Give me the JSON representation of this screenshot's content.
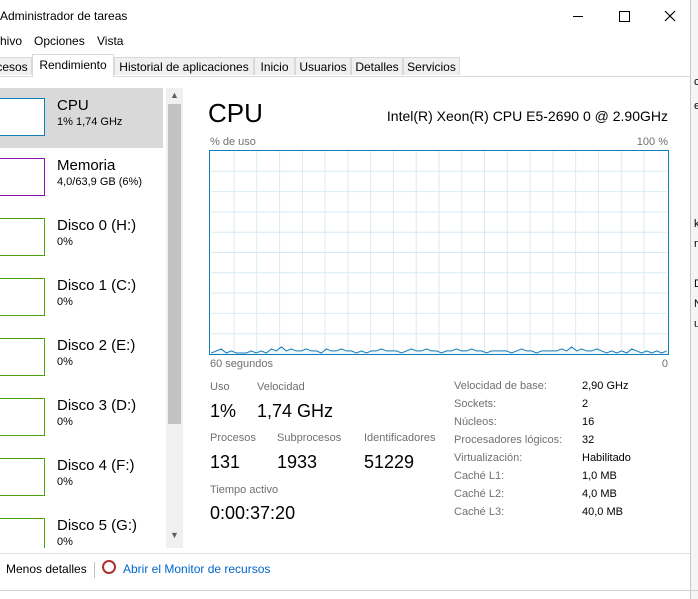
{
  "window": {
    "title": "Administrador de tareas"
  },
  "menu": [
    "hivo",
    "Opciones",
    "Vista"
  ],
  "tabs": [
    {
      "label": "cesos"
    },
    {
      "label": "Rendimiento",
      "active": true
    },
    {
      "label": "Historial de aplicaciones"
    },
    {
      "label": "Inicio"
    },
    {
      "label": "Usuarios"
    },
    {
      "label": "Detalles"
    },
    {
      "label": "Servicios"
    }
  ],
  "sidebar": {
    "items": [
      {
        "title": "CPU",
        "sub": "1% 1,74 GHz",
        "color": "#117dbb",
        "selected": true
      },
      {
        "title": "Memoria",
        "sub": "4,0/63,9 GB (6%)",
        "color": "#8b12ae"
      },
      {
        "title": "Disco 0 (H:)",
        "sub": "0%",
        "color": "#4da60c"
      },
      {
        "title": "Disco 1 (C:)",
        "sub": "0%",
        "color": "#4da60c"
      },
      {
        "title": "Disco 2 (E:)",
        "sub": "0%",
        "color": "#4da60c"
      },
      {
        "title": "Disco 3 (D:)",
        "sub": "0%",
        "color": "#4da60c"
      },
      {
        "title": "Disco 4 (F:)",
        "sub": "0%",
        "color": "#4da60c"
      },
      {
        "title": "Disco 5 (G:)",
        "sub": "0%",
        "color": "#4da60c"
      }
    ]
  },
  "main": {
    "heading": "CPU",
    "cpu_name": "Intel(R) Xeon(R) CPU E5-2690 0 @ 2.90GHz",
    "graph": {
      "top_left": "% de uso",
      "top_right": "100 %",
      "bottom_left": "60 segundos",
      "bottom_right": "0",
      "color": "#117dbb",
      "usage_percent": [
        0,
        1,
        2,
        0,
        1,
        0,
        0,
        0,
        1,
        0,
        1,
        0,
        2,
        1,
        3,
        1,
        2,
        1,
        1,
        2,
        1,
        1,
        0,
        2,
        1,
        1,
        2,
        1,
        1,
        0,
        1,
        0,
        1,
        1,
        2,
        1,
        1,
        1,
        0,
        1,
        2,
        1,
        1,
        2,
        1,
        1,
        0,
        1,
        1,
        2,
        1,
        1,
        2,
        1,
        1,
        0,
        1,
        1,
        1,
        1,
        0,
        1,
        2,
        1,
        1,
        0,
        1,
        1,
        1,
        1,
        2,
        1,
        3,
        1,
        2,
        1,
        1,
        2,
        1,
        0,
        1,
        0,
        1,
        0,
        2,
        1,
        0,
        1,
        0,
        1,
        0,
        1
      ]
    },
    "stats": {
      "uso_label": "Uso",
      "uso_value": "1%",
      "velocidad_label": "Velocidad",
      "velocidad_value": "1,74 GHz",
      "procesos_label": "Procesos",
      "procesos_value": "131",
      "subprocesos_label": "Subprocesos",
      "subprocesos_value": "1933",
      "identificadores_label": "Identificadores",
      "identificadores_value": "51229",
      "tiempo_label": "Tiempo activo",
      "tiempo_value": "0:00:37:20"
    },
    "properties": [
      {
        "label": "Velocidad de base:",
        "value": "2,90 GHz"
      },
      {
        "label": "Sockets:",
        "value": "2"
      },
      {
        "label": "Núcleos:",
        "value": "16"
      },
      {
        "label": "Procesadores lógicos:",
        "value": "32"
      },
      {
        "label": "Virtualización:",
        "value": "Habilitado"
      },
      {
        "label": "Caché L1:",
        "value": "1,0 MB"
      },
      {
        "label": "Caché L2:",
        "value": "4,0 MB"
      },
      {
        "label": "Caché L3:",
        "value": "40,0 MB"
      }
    ]
  },
  "footer": {
    "less_details": "Menos detalles",
    "monitor_link": "Abrir el Monitor de recursos"
  },
  "bg_window_chars": [
    "c",
    "e",
    "k",
    "m",
    "D",
    "N",
    "u"
  ]
}
